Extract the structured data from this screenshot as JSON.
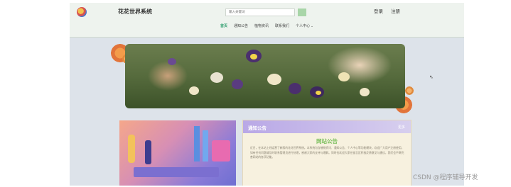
{
  "header": {
    "site_title": "花花世界系统",
    "search_placeholder": "输入关键词",
    "login_label": "登录",
    "register_label": "注册"
  },
  "nav": {
    "items": [
      "首页",
      "通知公告",
      "植物资讯",
      "联系我们",
      "个人中心"
    ]
  },
  "notice": {
    "title": "通知公告",
    "more_label": "更多",
    "body_title": "网站公告",
    "body_text": "近日，在本站上线运营了新版的花花世界系统。本系统包含植物资讯、通知公告、个人中心等功能模块，欢迎广大用户注册使用，如有任何问题请及时联系管理员进行处理，感谢大家的支持与理解。同时也欢迎大家在留言区积极反馈意见与建议，我们会不断完善网站的各项功能。"
  },
  "watermark": "CSDN @程序辅导开发",
  "colors": {
    "nav_active": "#2e9e6e",
    "notice_header": "#b9a8e6",
    "notice_title": "#7bbf5d"
  }
}
